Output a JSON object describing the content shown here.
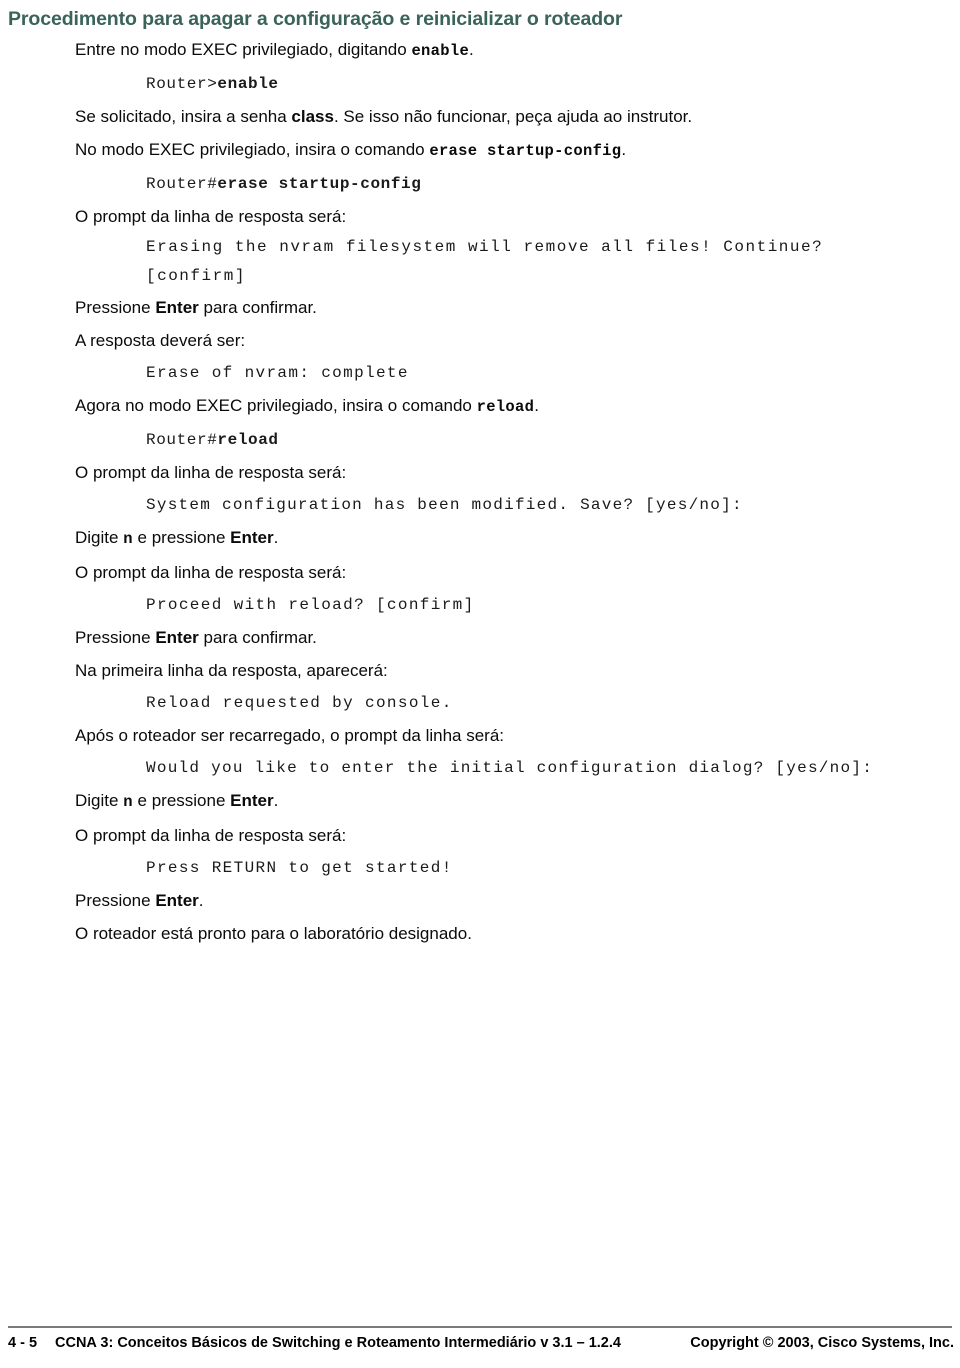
{
  "heading": "Procedimento para apagar a configuração e reinicializar o roteador",
  "lines": [
    {
      "type": "body",
      "pre": "Entre no modo EXEC privilegiado, digitando ",
      "mono": "enable",
      "post": "."
    },
    {
      "type": "code",
      "plain": "Router>",
      "bold": "enable"
    },
    {
      "type": "body",
      "pre": "Se solicitado, insira a senha ",
      "bold": "class",
      "post": ". Se isso não funcionar, peça ajuda ao instrutor."
    },
    {
      "type": "body",
      "pre": "No modo EXEC privilegiado, insira o comando ",
      "mono": "erase startup-config",
      "post": "."
    },
    {
      "type": "code",
      "plain": "Router#",
      "bold": "erase startup-config"
    },
    {
      "type": "body",
      "pre": "O prompt da linha de resposta será:"
    },
    {
      "type": "code",
      "plain": "Erasing the nvram filesystem will remove all files! Continue?\n[confirm]"
    },
    {
      "type": "body",
      "pre": "Pressione ",
      "bold": "Enter",
      "post": " para confirmar."
    },
    {
      "type": "body",
      "pre": "A resposta deverá ser:"
    },
    {
      "type": "code",
      "plain": "Erase of nvram: complete"
    },
    {
      "type": "body",
      "pre": "Agora no modo EXEC privilegiado, insira o comando ",
      "mono": "reload",
      "post": "."
    },
    {
      "type": "code",
      "plain": "Router#",
      "bold": "reload"
    },
    {
      "type": "body",
      "pre": "O prompt da linha de resposta será:"
    },
    {
      "type": "code",
      "plain": "System configuration has been modified. Save? [yes/no]:"
    },
    {
      "type": "body",
      "pre": "Digite ",
      "mono": "n",
      "post": " e pressione ",
      "bold2": "Enter",
      "post2": "."
    },
    {
      "type": "body",
      "pre": "O prompt da linha de resposta será:"
    },
    {
      "type": "code",
      "plain": "Proceed with reload? [confirm]"
    },
    {
      "type": "body",
      "pre": "Pressione ",
      "bold": "Enter",
      "post": " para confirmar."
    },
    {
      "type": "body",
      "pre": "Na primeira linha da resposta, aparecerá:"
    },
    {
      "type": "code",
      "plain": "Reload requested by console."
    },
    {
      "type": "body",
      "pre": "Após o roteador ser recarregado, o prompt da linha será:"
    },
    {
      "type": "code",
      "plain": "Would you like to enter the initial configuration dialog? [yes/no]:"
    },
    {
      "type": "body",
      "pre": "Digite ",
      "mono": "n",
      "post": " e pressione ",
      "bold2": "Enter",
      "post2": "."
    },
    {
      "type": "body",
      "pre": "O prompt da linha de resposta será:"
    },
    {
      "type": "code",
      "plain": "Press RETURN to get started!"
    },
    {
      "type": "body",
      "pre": "Pressione ",
      "bold": "Enter",
      "post": "."
    },
    {
      "type": "body",
      "pre": "O roteador está pronto para o laboratório designado."
    }
  ],
  "footer": {
    "page_number": "4 - 5",
    "title": "CCNA 3: Conceitos Básicos de Switching e Roteamento Intermediário v 3.1 – 1.2.4",
    "copyright": "Copyright © 2003, Cisco Systems, Inc."
  },
  "colors": {
    "heading": "#3a6359",
    "text": "#0a0a0a",
    "rule": "#7a7a7a"
  }
}
